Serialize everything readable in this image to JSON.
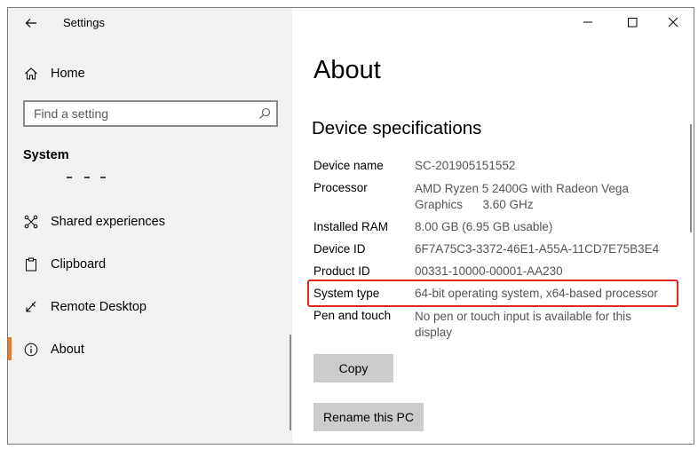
{
  "titlebar": {
    "app_title": "Settings",
    "controls": [
      "minimize-icon",
      "maximize-icon",
      "close-icon"
    ]
  },
  "sidebar": {
    "home_label": "Home",
    "search_placeholder": "Find a setting",
    "section_header": "System",
    "items": [
      {
        "label": "Shared experiences",
        "icon": "shared-experiences-icon"
      },
      {
        "label": "Clipboard",
        "icon": "clipboard-icon"
      },
      {
        "label": "Remote Desktop",
        "icon": "remote-desktop-icon"
      },
      {
        "label": "About",
        "icon": "info-icon",
        "selected": true
      }
    ]
  },
  "main": {
    "title": "About",
    "subheading": "Device specifications",
    "specs": [
      {
        "label": "Device name",
        "value": "SC-201905151552"
      },
      {
        "label": "Processor",
        "value": "AMD Ryzen 5 2400G with Radeon Vega Graphics      3.60 GHz"
      },
      {
        "label": "Installed RAM",
        "value": "8.00 GB (6.95 GB usable)"
      },
      {
        "label": "Device ID",
        "value": "6F7A75C3-3372-46E1-A55A-11CD7E75B3E4"
      },
      {
        "label": "Product ID",
        "value": "00331-10000-00001-AA230"
      },
      {
        "label": "System type",
        "value": "64-bit operating system, x64-based processor"
      },
      {
        "label": "Pen and touch",
        "value": "No pen or touch input is available for this display"
      }
    ],
    "copy_button": "Copy",
    "rename_button": "Rename this PC"
  },
  "colors": {
    "accent": "#e67e22",
    "highlight": "#e0251f",
    "sidebar_bg": "#f2f2f2",
    "button_bg": "#cccccc"
  }
}
